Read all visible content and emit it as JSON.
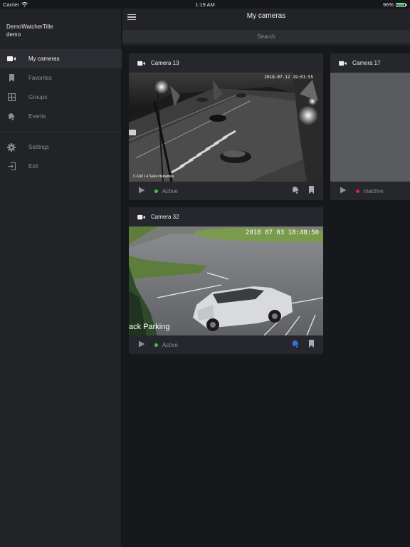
{
  "status_bar": {
    "carrier": "Carrier",
    "time": "1:19 AM",
    "battery_percent": "96%",
    "battery_level": 0.96,
    "battery_color": "#34c759"
  },
  "sidebar": {
    "app_title": "DemoWatcherTitle",
    "username": "demo",
    "items": [
      {
        "label": "My cameras",
        "icon": "video-camera-icon",
        "active": true
      },
      {
        "label": "Favorites",
        "icon": "bookmark-icon",
        "active": false
      },
      {
        "label": "Groups",
        "icon": "grid-icon",
        "active": false
      },
      {
        "label": "Events",
        "icon": "bell-icon",
        "active": false
      }
    ],
    "secondary_items": [
      {
        "label": "Settings",
        "icon": "gear-icon"
      },
      {
        "label": "Exit",
        "icon": "exit-icon"
      }
    ]
  },
  "header": {
    "title": "My cameras",
    "menu_icon": "hamburger-menu-icon"
  },
  "search": {
    "placeholder": "Search"
  },
  "cameras": [
    {
      "name": "Camera 13",
      "status": "Active",
      "status_color": "#2ecc40",
      "overlay_timestamp": "2018-07-12 19:01:55",
      "overlay_label": "CAM 14 Sala visitantes",
      "feed_style": "night-grayscale",
      "events_icon_color": "#a9aaaf"
    },
    {
      "name": "Camera 17",
      "status": "Inactive",
      "status_color": "#e0243a",
      "feed_style": "blank"
    },
    {
      "name": "Camera 32",
      "status": "Active",
      "status_color": "#2ecc40",
      "overlay_timestamp": "2018 07 03 18:48:50",
      "overlay_label": "ack Parking",
      "feed_style": "day-parking",
      "events_icon_color": "#3a6fe0"
    }
  ],
  "colors": {
    "background": "#17181c",
    "sidebar": "#222327",
    "card": "#26272c",
    "active_green": "#2ecc40",
    "inactive_red": "#e0243a",
    "events_blue": "#3a6fe0"
  }
}
